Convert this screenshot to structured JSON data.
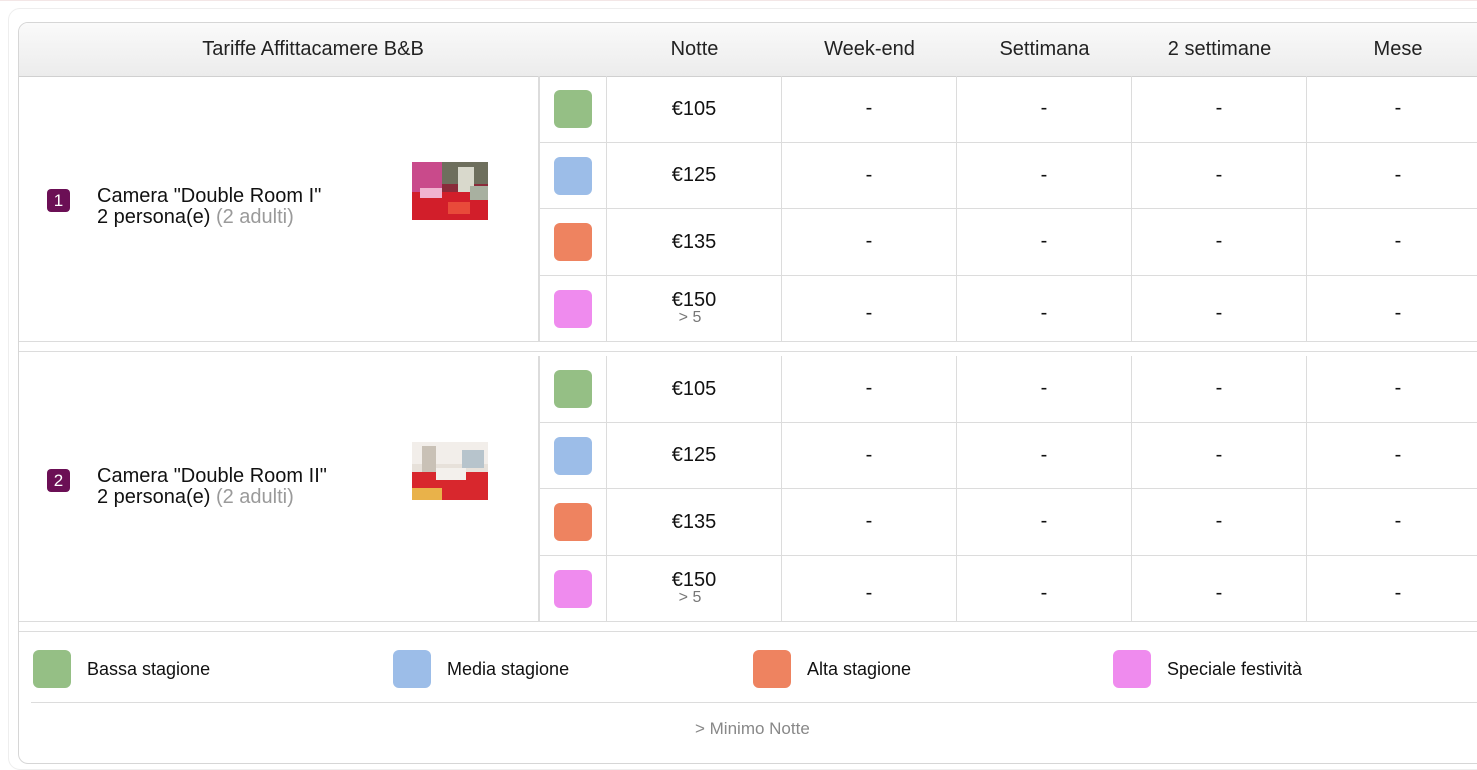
{
  "colors": {
    "bassa": "#95bf85",
    "media": "#9cbde8",
    "alta": "#ee8360",
    "speciale": "#ef8bee",
    "badge": "#6b0f55"
  },
  "table": {
    "title": "Tariffe Affittacamere B&B",
    "columns": [
      "Notte",
      "Week-end",
      "Settimana",
      "2 settimane",
      "Mese"
    ]
  },
  "rooms": [
    {
      "number": "1",
      "name": "Camera \"Double Room I\"",
      "capacity": "2 persona(e)",
      "guests": "(2 adulti)",
      "photo_icon": "room-photo",
      "rates": [
        {
          "season": "bassa",
          "notte": "€105",
          "min": "",
          "weekend": "-",
          "settimana": "-",
          "due_settimane": "-",
          "mese": "-"
        },
        {
          "season": "media",
          "notte": "€125",
          "min": "",
          "weekend": "-",
          "settimana": "-",
          "due_settimane": "-",
          "mese": "-"
        },
        {
          "season": "alta",
          "notte": "€135",
          "min": "",
          "weekend": "-",
          "settimana": "-",
          "due_settimane": "-",
          "mese": "-"
        },
        {
          "season": "speciale",
          "notte": "€150",
          "min": "> 5",
          "weekend": "-",
          "settimana": "-",
          "due_settimane": "-",
          "mese": "-"
        }
      ]
    },
    {
      "number": "2",
      "name": "Camera \"Double Room II\"",
      "capacity": "2 persona(e)",
      "guests": "(2 adulti)",
      "photo_icon": "room-photo",
      "rates": [
        {
          "season": "bassa",
          "notte": "€105",
          "min": "",
          "weekend": "-",
          "settimana": "-",
          "due_settimane": "-",
          "mese": "-"
        },
        {
          "season": "media",
          "notte": "€125",
          "min": "",
          "weekend": "-",
          "settimana": "-",
          "due_settimane": "-",
          "mese": "-"
        },
        {
          "season": "alta",
          "notte": "€135",
          "min": "",
          "weekend": "-",
          "settimana": "-",
          "due_settimane": "-",
          "mese": "-"
        },
        {
          "season": "speciale",
          "notte": "€150",
          "min": "> 5",
          "weekend": "-",
          "settimana": "-",
          "due_settimane": "-",
          "mese": "-"
        }
      ]
    }
  ],
  "legend": {
    "items": [
      {
        "season": "bassa",
        "label": "Bassa stagione"
      },
      {
        "season": "media",
        "label": "Media stagione"
      },
      {
        "season": "alta",
        "label": "Alta stagione"
      },
      {
        "season": "speciale",
        "label": "Speciale festività"
      }
    ],
    "note": "> Minimo Notte"
  }
}
